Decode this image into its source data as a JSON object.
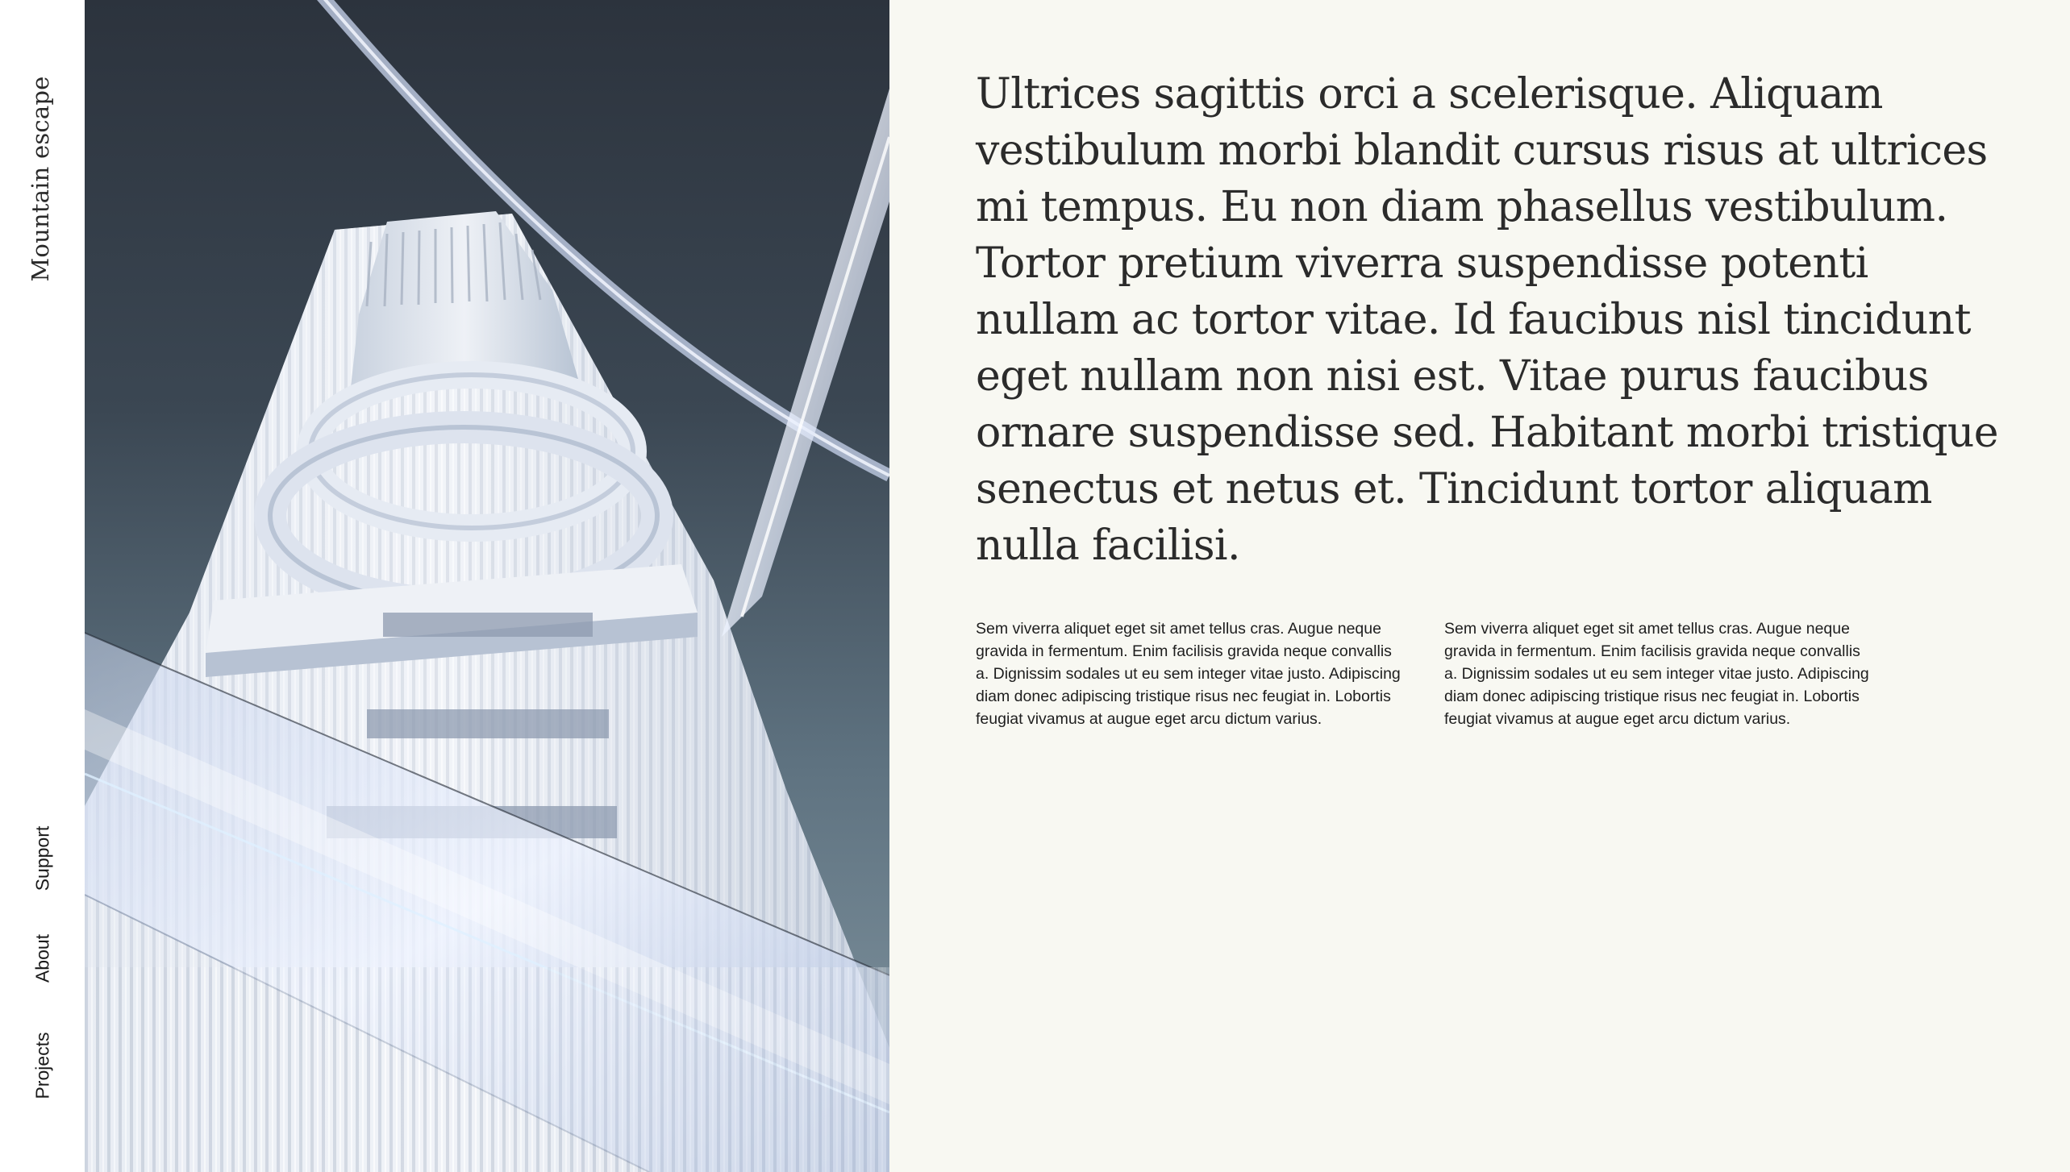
{
  "sidebar": {
    "brand": "Mountain escape",
    "nav": {
      "support": "Support",
      "about": "About",
      "projects": "Projects"
    }
  },
  "hero": {
    "image": "abstract-glass-tower-illustration"
  },
  "main": {
    "lead": "Ultrices sagittis orci a scelerisque. Aliquam vestibulum morbi blandit cursus risus at ultrices mi tempus. Eu non diam phasellus vestibulum. Tortor pretium viverra suspendisse potenti nullam ac tortor vitae. Id faucibus nisl tincidunt eget nullam non nisi est.  Vitae purus faucibus ornare suspendisse sed. Habitant morbi tristique senectus et netus et. Tincidunt tortor aliquam nulla facilisi.",
    "columns": [
      "Sem viverra aliquet eget sit amet tellus cras. Augue neque gravida in fermentum. Enim facilisis gravida neque convallis a. Dignissim sodales ut eu sem integer vitae justo. Adipiscing diam donec adipiscing tristique risus nec feugiat in. Lobortis feugiat vivamus at augue eget arcu dictum varius.",
      "Sem viverra aliquet eget sit amet tellus cras. Augue neque gravida in fermentum. Enim facilisis gravida neque convallis a. Dignissim sodales ut eu sem integer vitae justo. Adipiscing diam donec adipiscing tristique risus nec feugiat in. Lobortis feugiat vivamus at augue eget arcu dictum varius."
    ]
  },
  "colors": {
    "background": "#f8f8f2",
    "sidebar": "#ffffff",
    "text": "#2b2b2b",
    "sky_top": "#2c333d",
    "sky_bottom": "#8598a3"
  }
}
